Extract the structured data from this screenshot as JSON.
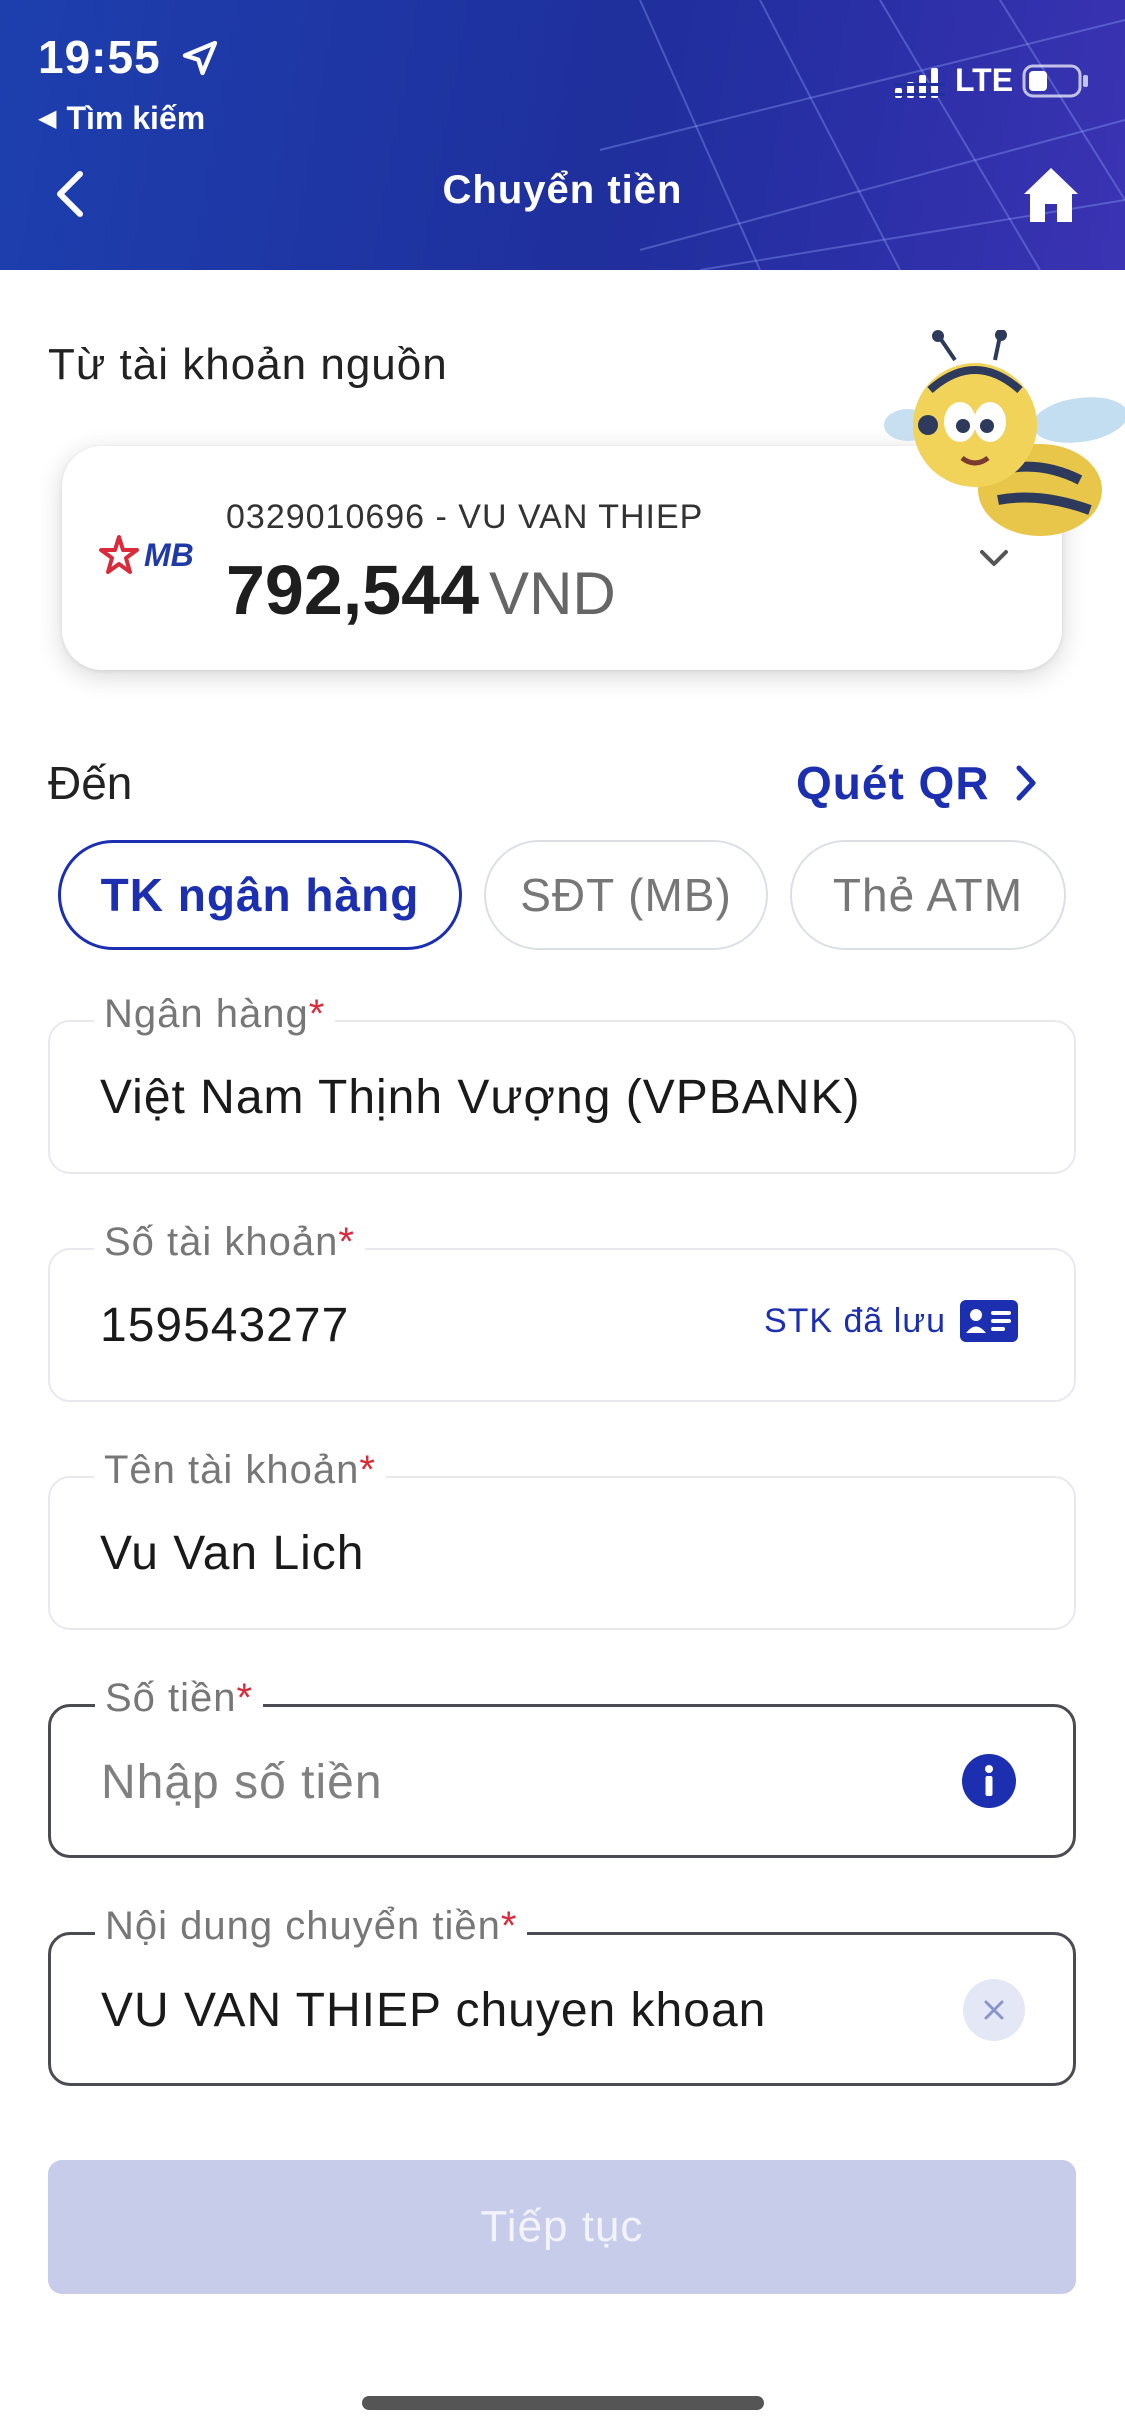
{
  "status_bar": {
    "time": "19:55",
    "back_app_label": "Tìm kiếm",
    "network": "LTE"
  },
  "nav": {
    "title": "Chuyển tiền"
  },
  "source": {
    "section_label": "Từ tài khoản nguồn",
    "bank_logo_text": "MB",
    "account_line": "0329010696 - VU VAN THIEP",
    "balance": "792,544",
    "currency": "VND"
  },
  "destination": {
    "label": "Đến",
    "scan_qr": "Quét QR",
    "tabs": [
      {
        "label": "TK ngân hàng",
        "active": true
      },
      {
        "label": "SĐT (MB)",
        "active": false
      },
      {
        "label": "Thẻ ATM",
        "active": false
      }
    ]
  },
  "form": {
    "bank": {
      "label": "Ngân hàng",
      "required_mark": "*",
      "value": "Việt Nam Thịnh Vượng (VPBANK)"
    },
    "account_number": {
      "label": "Số tài khoản",
      "required_mark": "*",
      "value": "159543277",
      "saved_link": "STK đã lưu"
    },
    "account_name": {
      "label": "Tên tài khoản",
      "required_mark": "*",
      "value": "Vu Van Lich"
    },
    "amount": {
      "label": "Số tiền",
      "required_mark": "*",
      "placeholder": "Nhập số tiền"
    },
    "content": {
      "label": "Nội dung chuyển tiền",
      "required_mark": "*",
      "value": "VU VAN THIEP chuyen khoan"
    }
  },
  "actions": {
    "continue_label": "Tiếp tục"
  },
  "colors": {
    "brand_blue": "#1b2fb0",
    "header_blue": "#1f2f9c",
    "required_red": "#d92b3a",
    "disabled_button": "#c7ccea"
  },
  "icons": [
    "location-arrow-icon",
    "signal-icon",
    "battery-icon",
    "back-chevron-icon",
    "home-icon",
    "mb-star-logo-icon",
    "chevron-down-icon",
    "chevron-right-icon",
    "saved-contacts-card-icon",
    "info-icon",
    "clear-icon",
    "mascot-bee-illustration"
  ]
}
